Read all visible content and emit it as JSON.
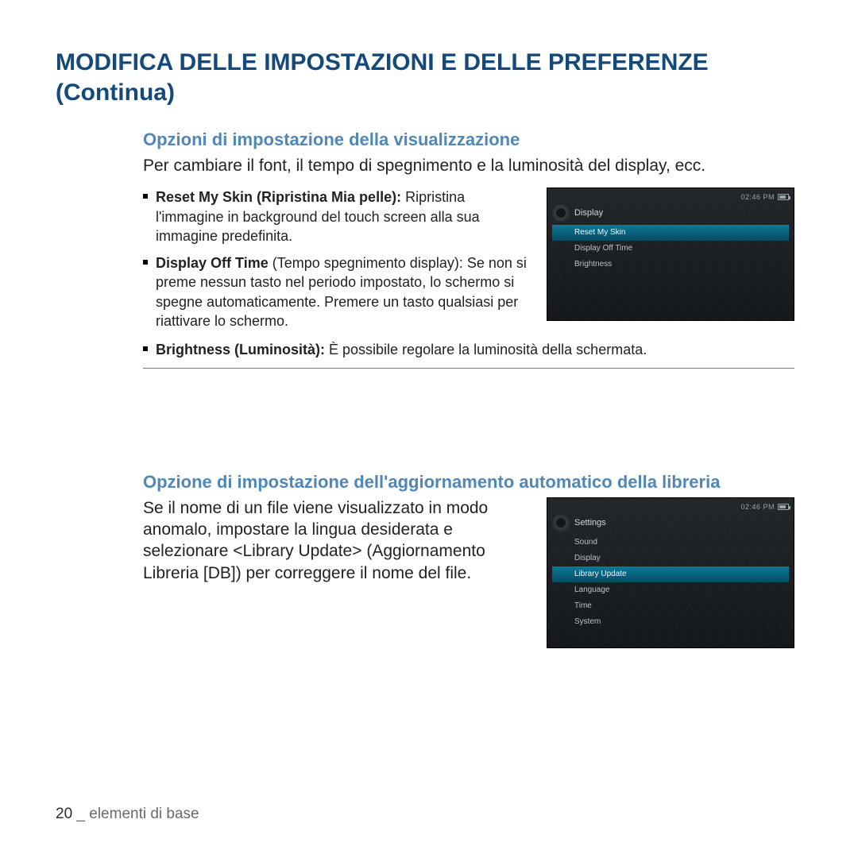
{
  "page": {
    "title": "MODIFICA DELLE IMPOSTAZIONI E DELLE PREFERENZE (Continua)"
  },
  "section1": {
    "heading": "Opzioni di impostazione della visualizzazione",
    "intro": "Per cambiare il font, il tempo di spegnimento e la luminosità del display, ecc.",
    "bullets": {
      "b1_bold": "Reset My Skin (Ripristina Mia pelle): ",
      "b1_rest": "Ripristina l'immagine in background del touch screen alla sua immagine predefinita.",
      "b2_bold": "Display Off Time ",
      "b2_rest": "(Tempo spegnimento display): Se non si preme nessun tasto nel periodo impostato, lo schermo si spegne automaticamente. Premere un tasto qualsiasi per riattivare lo schermo.",
      "b3_bold": "Brightness (Luminosità): ",
      "b3_rest": "È possibile regolare la luminosità della schermata."
    }
  },
  "device1": {
    "time": "02:46 PM",
    "header": "Display",
    "items": {
      "i0": "Reset My Skin",
      "i1": "Display Off Time",
      "i2": "Brightness"
    }
  },
  "section2": {
    "heading": "Opzione di impostazione dell'aggiornamento automatico della libreria",
    "body": "Se il nome di un file viene visualizzato in modo anomalo, impostare la lingua desiderata e selezionare <Library Update> (Aggiornamento Libreria [DB]) per correggere il nome del file."
  },
  "device2": {
    "time": "02:46 PM",
    "header": "Settings",
    "items": {
      "i0": "Sound",
      "i1": "Display",
      "i2": "Library Update",
      "i3": "Language",
      "i4": "Time",
      "i5": "System"
    }
  },
  "footer": {
    "page_number": "20",
    "sep": " _ ",
    "section": "elementi di base"
  }
}
